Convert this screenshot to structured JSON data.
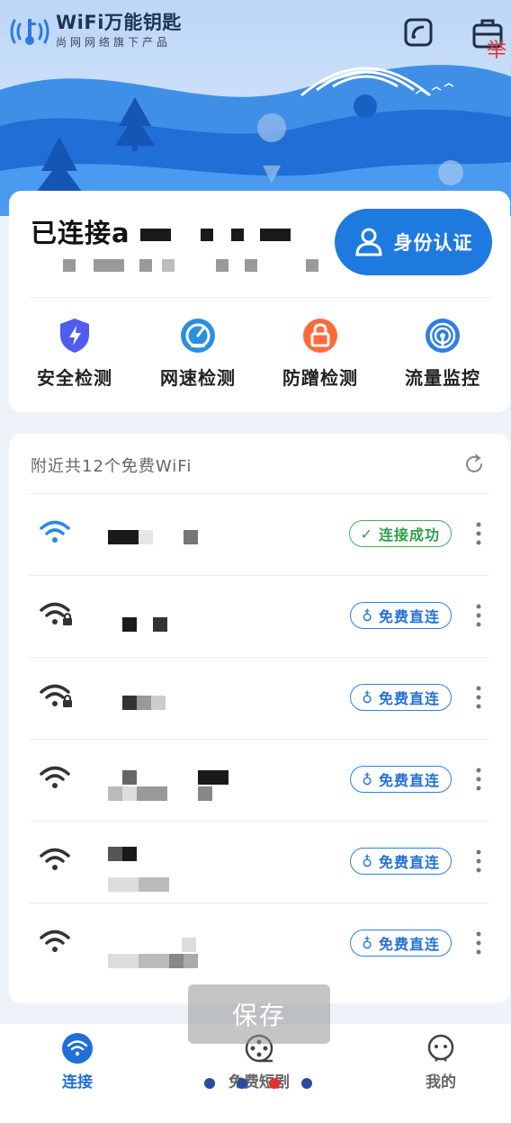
{
  "app": {
    "title": "WiFi万能钥匙",
    "subtitle": "尚网网络旗下产品",
    "corner_char": "举"
  },
  "status": {
    "title": "已连接a",
    "auth_button": "身份认证"
  },
  "tools": [
    {
      "label": "安全检测",
      "icon": "shield-icon",
      "color": "#4e5cf0"
    },
    {
      "label": "网速检测",
      "icon": "speedometer-icon",
      "color": "#2b8fe0"
    },
    {
      "label": "防蹭检测",
      "icon": "lock-icon",
      "color": "#ff6a3d"
    },
    {
      "label": "流量监控",
      "icon": "signal-icon",
      "color": "#2f7fe2"
    }
  ],
  "nearby": {
    "header": "附近共12个免费WiFi",
    "networks": [
      {
        "action": "连接成功",
        "state": "connected",
        "signal": "full-blue"
      },
      {
        "action": "免费直连",
        "state": "free",
        "signal": "locked"
      },
      {
        "action": "免费直连",
        "state": "free",
        "signal": "locked"
      },
      {
        "action": "免费直连",
        "state": "free",
        "signal": "full"
      },
      {
        "action": "免费直连",
        "state": "free",
        "signal": "full"
      },
      {
        "action": "免费直连",
        "state": "free",
        "signal": "full"
      }
    ]
  },
  "toast": "保存",
  "nav": [
    {
      "label": "连接",
      "active": true
    },
    {
      "label": "免费短剧",
      "active": false
    },
    {
      "label": "我的",
      "active": false
    }
  ],
  "colors": {
    "accent": "#1f7ae0",
    "success": "#2e9e4a",
    "nav_active": "#1f6fd6"
  }
}
